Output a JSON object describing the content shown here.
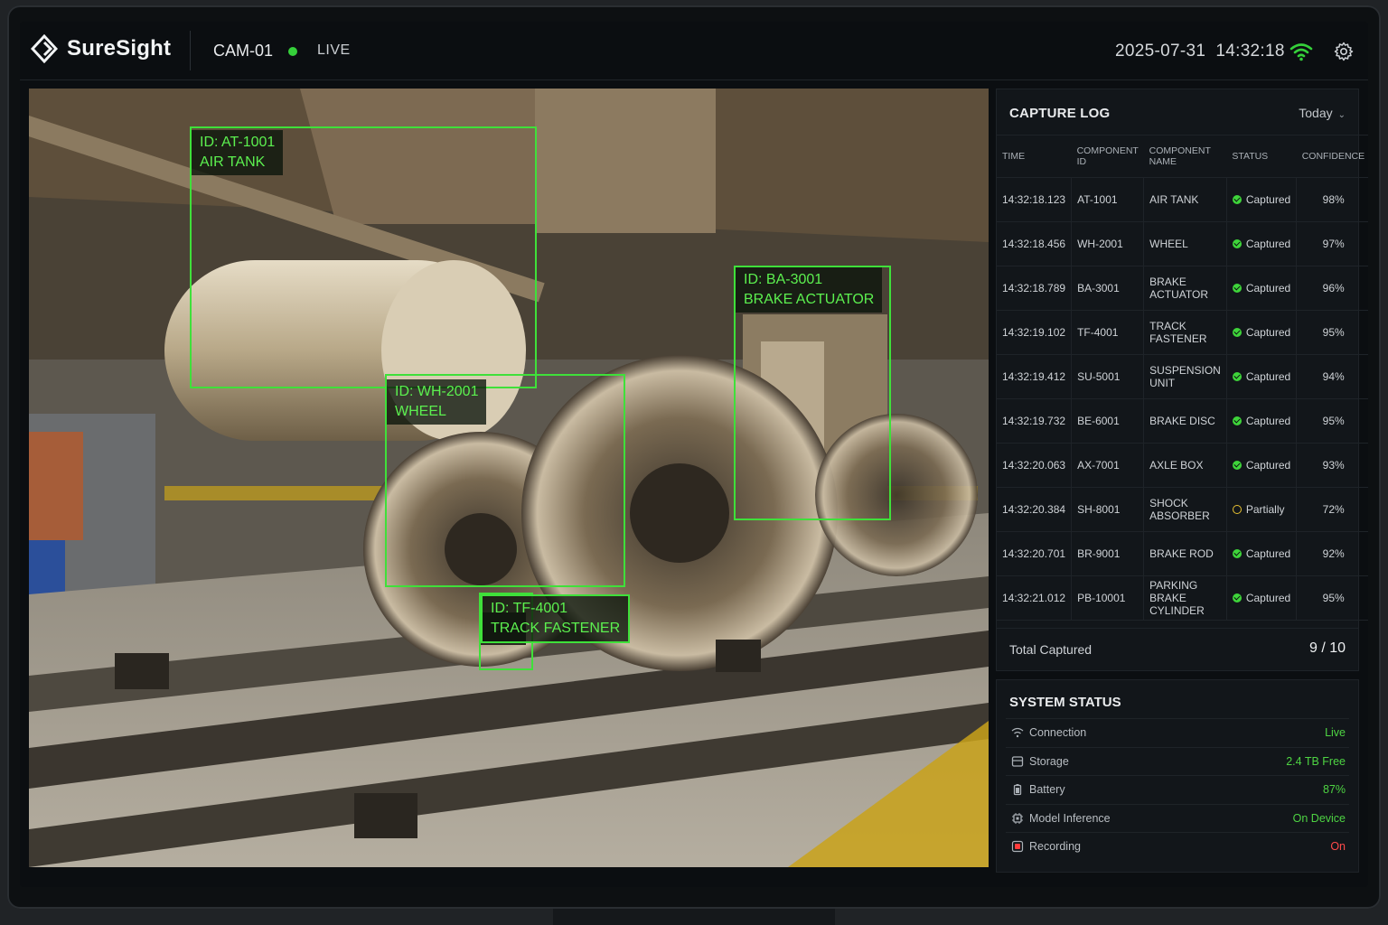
{
  "header": {
    "brand": "SureSight",
    "camera": "CAM-01",
    "live_label": "LIVE",
    "date": "2025-07-31",
    "time": "14:32:18"
  },
  "detections": [
    {
      "id": "ID: AT-1001",
      "name": "AIR TANK"
    },
    {
      "id": "ID: WH-2001",
      "name": "WHEEL"
    },
    {
      "id": "ID: BA-3001",
      "name": "BRAKE ACTUATOR"
    },
    {
      "id": "ID: TF-4001",
      "name": "TRACK FASTENER"
    }
  ],
  "capture_log": {
    "title": "CAPTURE LOG",
    "period": "Today",
    "columns": [
      "TIME",
      "COMPONENT ID",
      "COMPONENT NAME",
      "STATUS",
      "CONFIDENCE"
    ],
    "rows": [
      {
        "time": "14:32:18.123",
        "id": "AT-1001",
        "name": "AIR TANK",
        "status": "Captured",
        "confidence": "98%"
      },
      {
        "time": "14:32:18.456",
        "id": "WH-2001",
        "name": "WHEEL",
        "status": "Captured",
        "confidence": "97%"
      },
      {
        "time": "14:32:18.789",
        "id": "BA-3001",
        "name": "BRAKE ACTUATOR",
        "status": "Captured",
        "confidence": "96%"
      },
      {
        "time": "14:32:19.102",
        "id": "TF-4001",
        "name": "TRACK FASTENER",
        "status": "Captured",
        "confidence": "95%"
      },
      {
        "time": "14:32:19.412",
        "id": "SU-5001",
        "name": "SUSPENSION UNIT",
        "status": "Captured",
        "confidence": "94%"
      },
      {
        "time": "14:32:19.732",
        "id": "BE-6001",
        "name": "BRAKE DISC",
        "status": "Captured",
        "confidence": "95%"
      },
      {
        "time": "14:32:20.063",
        "id": "AX-7001",
        "name": "AXLE BOX",
        "status": "Captured",
        "confidence": "93%"
      },
      {
        "time": "14:32:20.384",
        "id": "SH-8001",
        "name": "SHOCK ABSORBER",
        "status": "Partially",
        "confidence": "72%"
      },
      {
        "time": "14:32:20.701",
        "id": "BR-9001",
        "name": "BRAKE ROD",
        "status": "Captured",
        "confidence": "92%"
      },
      {
        "time": "14:32:21.012",
        "id": "PB-10001",
        "name": "PARKING BRAKE CYLINDER",
        "status": "Captured",
        "confidence": "95%"
      }
    ],
    "total_label": "Total Captured",
    "total_value": "9 / 10"
  },
  "system_status": {
    "title": "SYSTEM STATUS",
    "items": [
      {
        "label": "Connection",
        "value": "Live",
        "icon": "wifi-icon",
        "color": "#4ed443"
      },
      {
        "label": "Storage",
        "value": "2.4 TB Free",
        "icon": "storage-icon",
        "color": "#4ed443"
      },
      {
        "label": "Battery",
        "value": "87%",
        "icon": "battery-icon",
        "color": "#4ed443"
      },
      {
        "label": "Model Inference",
        "value": "On Device",
        "icon": "chip-icon",
        "color": "#4ed443"
      },
      {
        "label": "Recording",
        "value": "On",
        "icon": "record-icon",
        "color": "#ff4a4a"
      }
    ]
  },
  "colors": {
    "accent_green": "#3fe03a",
    "live_dot": "#35d03a",
    "partial_yellow": "#e7c132",
    "recording_red": "#ff4a4a"
  }
}
